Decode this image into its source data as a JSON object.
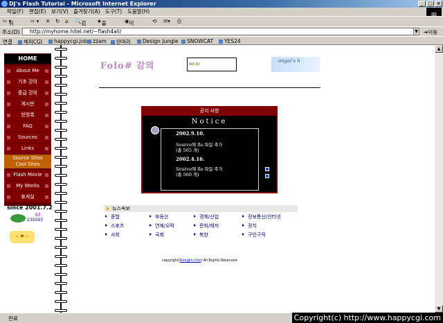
{
  "window": {
    "title": "DJ's Flash Tutorial - Microsoft Internet Explorer"
  },
  "menu": [
    "파일(F)",
    "편집(E)",
    "보기(V)",
    "즐겨찾기(A)",
    "도구(T)",
    "도움말(H)"
  ],
  "toolbar": {
    "back": "뒤로",
    "search": "검색",
    "favorites": "즐겨찾기",
    "media": "미디어"
  },
  "address": {
    "label": "주소(D)",
    "url": "http://myhome.hitel.net/~flash4all/",
    "go": "이동"
  },
  "links": {
    "label": "연결",
    "items": [
      "헤피CGI",
      "happycgi.job",
      "zzam",
      "딴머리",
      "Design Jungle",
      "SNOWCAT",
      "YES24"
    ]
  },
  "sidebar": {
    "home": "HOME",
    "items": [
      "About Me",
      "기초 강의",
      "중급 강의",
      "게시판",
      "방명록",
      "FAQ",
      "Sources",
      "Links"
    ],
    "source_sites": [
      "Source Sites",
      "Cool Sites"
    ],
    "items2": [
      "Flash Movie",
      "My Works",
      "휴게실"
    ],
    "since": "since 2001.7.2",
    "counter_today": "83",
    "counter_total": "235593"
  },
  "header": {
    "logo": "Folo# 강의",
    "flash_label": "we.kr",
    "angel": "angel's h"
  },
  "notice": {
    "header": "공지 사항",
    "title": "Notice",
    "entries": [
      {
        "date": "2002.9.10.",
        "line1": "Source에 fla 파일 추가",
        "line2": "(총 565 개)"
      },
      {
        "date": "2002.4.16.",
        "line1": "Source에 fla 파일 추가",
        "line2": "(총 560 개)"
      }
    ]
  },
  "news": {
    "header": "뉴스속보",
    "col1": [
      "종합",
      "스포츠",
      "사회"
    ],
    "col2": [
      "부동산",
      "연예/오락",
      "국제"
    ],
    "col3": [
      "경제/산업",
      "문화/레저",
      "북한"
    ],
    "col4": [
      "정보통신/인터넷",
      "정치",
      "구인구직"
    ]
  },
  "footer": {
    "pre": "copyright(",
    "name": "Dongjin Cho",
    "post": ") All Rights Reserved."
  },
  "status": "완료",
  "watermark": "Copyright(c) http://www.happycgi.com"
}
